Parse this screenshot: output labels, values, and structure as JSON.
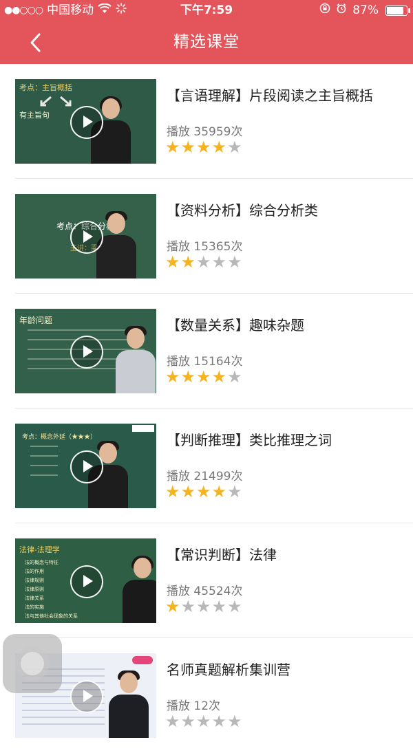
{
  "status_bar": {
    "signal": "●●○○○",
    "carrier": "中国移动",
    "wifi": "wifi-icon",
    "time": "下午7:59",
    "battery_text": "87%",
    "battery_level": 0.87
  },
  "header": {
    "title": "精选课堂",
    "back_icon": "chevron-left-icon"
  },
  "colors": {
    "header_bg": "#e4555b",
    "star_on": "#f5b320",
    "star_off": "#b8b8b8"
  },
  "courses": [
    {
      "title": "【言语理解】片段阅读之主旨概括",
      "plays": "播放 35959次",
      "rating": 4,
      "board_lines": [
        "考点：主旨概括",
        "有主旨句"
      ]
    },
    {
      "title": "【资料分析】综合分析类",
      "plays": "播放 15365次",
      "rating": 2,
      "board_lines": [
        "考点：综合分析类",
        "主讲：梁毅"
      ]
    },
    {
      "title": "【数量关系】趣味杂题",
      "plays": "播放 15164次",
      "rating": 4,
      "board_lines": [
        "年龄问题"
      ]
    },
    {
      "title": "【判断推理】类比推理之词",
      "plays": "播放 21499次",
      "rating": 4,
      "board_lines": [
        "考点：概念外延（★★★）"
      ]
    },
    {
      "title": "【常识判断】法律",
      "plays": "播放 45524次",
      "rating": 1,
      "board_lines": [
        "法律-法理学",
        "法的概念与特征",
        "法的作用",
        "法律规则",
        "法律原则",
        "法律关系",
        "法的实施",
        "法与其他社会现象的关系"
      ]
    },
    {
      "title": "名师真题解析集训营",
      "plays": "播放 12次",
      "rating": 0,
      "board_lines": []
    }
  ]
}
